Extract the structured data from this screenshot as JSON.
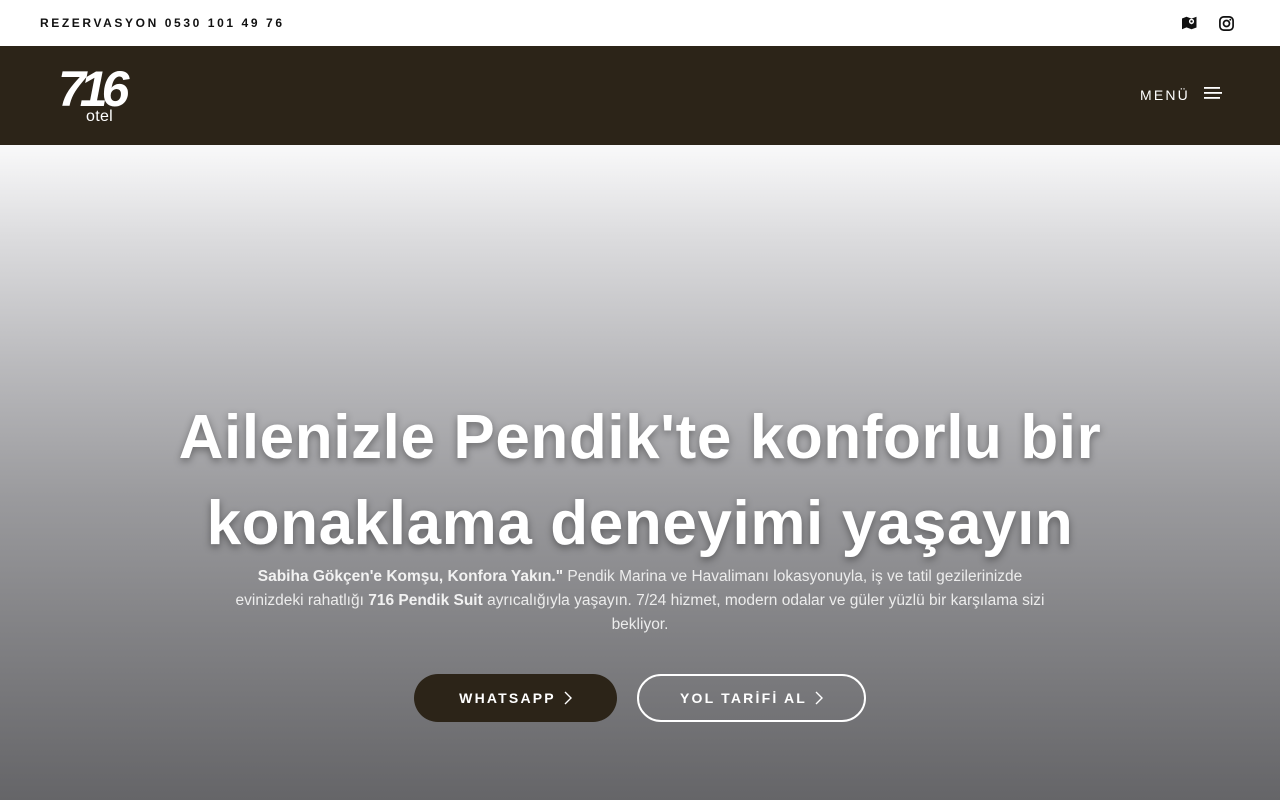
{
  "topbar": {
    "phone_label": "REZERVASYON 0530 101 49 76",
    "icons": [
      "map-icon",
      "instagram-icon"
    ]
  },
  "navbar": {
    "logo_mark": "716",
    "logo_sub": "otel",
    "menu_label": "MENÜ"
  },
  "hero": {
    "title_line1": "Ailenizle Pendik'te konforlu bir",
    "title_line2": "konaklama deneyimi yaşayın",
    "desc_bold1": "Sabiha Gökçen'e Komşu, Konfora Yakın.\"",
    "desc_text1": " Pendik Marina ve Havalimanı lokasyonuyla, iş ve tatil gezilerinizde evinizdeki rahatlığı ",
    "desc_bold2": "716 Pendik Suit",
    "desc_text2": " ayrıcalığıyla yaşayın. 7/24 hizmet, modern odalar ve güler yüzlü bir karşılama sizi bekliyor.",
    "btn_whatsapp": "WHATSAPP",
    "btn_directions": "YOL TARİFİ AL"
  },
  "colors": {
    "brand_dark": "#2c2418",
    "white": "#ffffff"
  }
}
